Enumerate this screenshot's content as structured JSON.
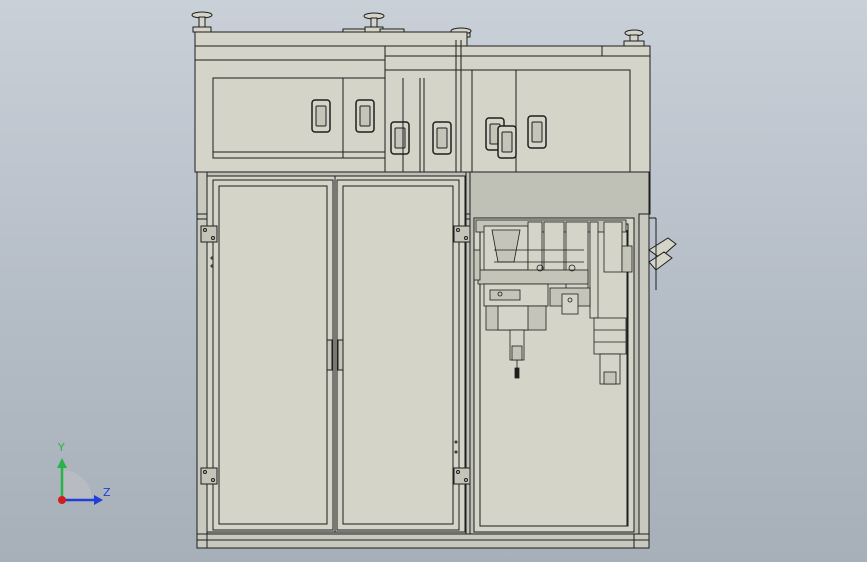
{
  "view": {
    "background_top": "#c9d0d8",
    "background_bottom": "#a7afb9"
  },
  "model": {
    "panel_fill": "#d4d4c8",
    "panel_fill_dark": "#c4c4b8",
    "line_color": "#1e1e1e",
    "frame_fill": "#bfc0b6"
  },
  "triad": {
    "x_label": "Y",
    "z_label": "Z",
    "y_color": "#29b24a",
    "z_color": "#1f3fd6",
    "origin_color": "#d01e1e"
  }
}
